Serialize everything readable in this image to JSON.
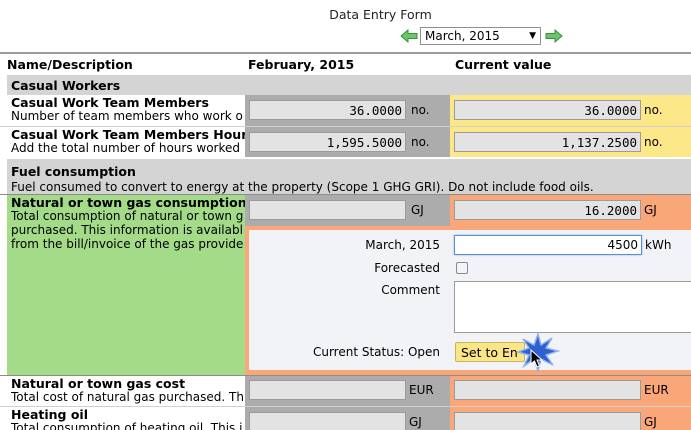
{
  "header": {
    "title": "Data Entry Form",
    "month_selected": "March, 2015"
  },
  "columns": {
    "name": "Name/Description",
    "prev": "February, 2015",
    "current": "Current value"
  },
  "sections": {
    "casual": {
      "title": "Casual Workers",
      "members": {
        "title": "Casual Work Team Members",
        "desc": "Number of team members who work oc...",
        "prev_value": "36.0000",
        "prev_unit": "no.",
        "cur_value": "36.0000",
        "cur_unit": "no."
      },
      "hours": {
        "title": "Casual Work Team Members Hours",
        "desc": "Add the total number of hours worked ...",
        "prev_value": "1,595.5000",
        "prev_unit": "no.",
        "cur_value": "1,137.2500",
        "cur_unit": "no."
      }
    },
    "fuel": {
      "title": "Fuel consumption",
      "desc": "Fuel consumed to convert to energy at the property (Scope 1 GHG GRI). Do not include food oils.",
      "gas": {
        "title": "Natural or town gas consumption",
        "desc_lines": [
          "Total consumption of natural or town gas",
          "purchased. This information is available",
          "from the bill/invoice of the gas provider."
        ],
        "prev_value": "",
        "prev_unit": "GJ",
        "cur_value": "16.2000",
        "cur_unit": "GJ",
        "detail": {
          "period_label": "March, 2015",
          "entry_value": "4500",
          "entry_unit": "kWh",
          "forecasted_label": "Forecasted",
          "comment_label": "Comment",
          "status_label": "Current Status: Open",
          "set_button": "Set to En"
        }
      },
      "gas_cost": {
        "title": "Natural or town gas cost",
        "desc": "Total cost of natural gas purchased. Thi...",
        "prev_unit": "EUR",
        "cur_unit": "EUR"
      },
      "heating_oil": {
        "title": "Heating oil",
        "desc": "Total consumption of heating oil. This in",
        "prev_unit": "GJ",
        "cur_unit": "GJ"
      }
    }
  },
  "colors": {
    "section_bg": "#d4d4d4",
    "prev_col_bg": "#acacac",
    "current_yellow": "#fce888",
    "current_orange": "#f9a679",
    "selected_green": "#a3db88",
    "arrow_green": "#5cb85c",
    "click_burst": "#2f5fd0"
  },
  "icons": {
    "prev": "left-arrow-icon",
    "next": "right-arrow-icon",
    "cursor": "mouse-pointer-icon",
    "click": "click-burst-icon"
  }
}
